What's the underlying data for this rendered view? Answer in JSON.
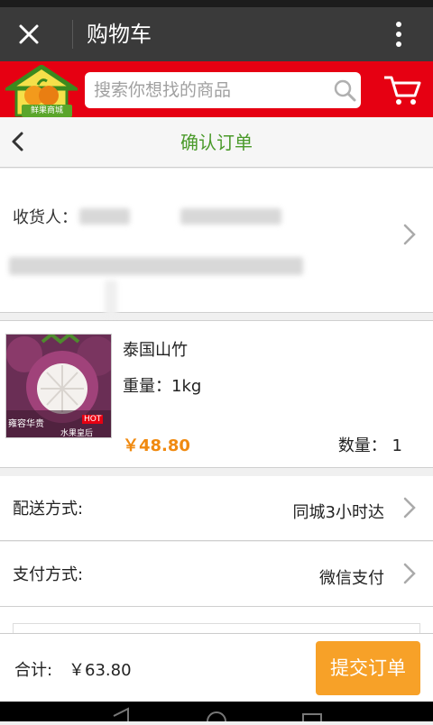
{
  "titlebar": {
    "title": "购物车"
  },
  "search": {
    "placeholder": "搜索你想找的商品"
  },
  "logo": {
    "text": "鲜果商城"
  },
  "page": {
    "title": "确认订单"
  },
  "address": {
    "receiver_label": "收货人："
  },
  "product": {
    "name": "泰国山竹",
    "weight": "重量：1kg",
    "price": "￥48.80",
    "quantity": "数量： 1",
    "image_caption": "雍容华贵",
    "image_badge": "HOT",
    "image_sub": "水果皇后"
  },
  "delivery": {
    "label": "配送方式:",
    "value": "同城3小时达"
  },
  "payment": {
    "label": "支付方式:",
    "value": "微信支付"
  },
  "footer": {
    "total_label": "合计:",
    "total_value": "￥63.80",
    "submit_label": "提交订单"
  },
  "colors": {
    "brand_red": "#e60012",
    "accent_orange": "#f7a128",
    "title_green": "#4a9a2a"
  }
}
